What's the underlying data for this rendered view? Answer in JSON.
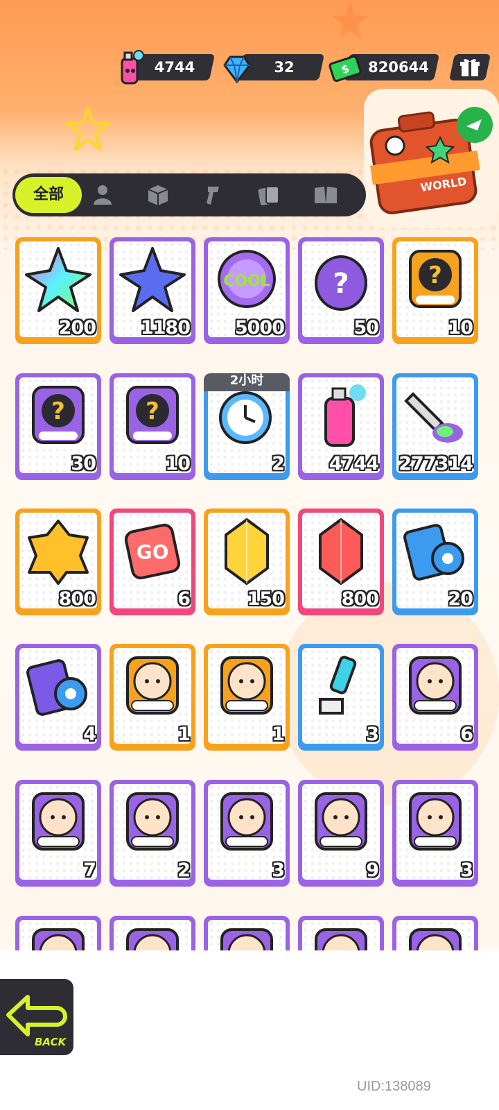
{
  "currencies": {
    "spray": "4744",
    "diamond": "32",
    "cash": "820644"
  },
  "event_banner": {
    "label": "WORLD"
  },
  "tabs": {
    "all_label": "全部",
    "icons": [
      "person-icon",
      "box-icon",
      "spray-gun-icon",
      "cards-icon",
      "book-icon"
    ]
  },
  "items": [
    {
      "name": "rainbow-star-crystal",
      "qty": "200",
      "rarity": "orange"
    },
    {
      "name": "blue-star-crystal",
      "qty": "1180",
      "rarity": "purple"
    },
    {
      "name": "cool-badge-coin",
      "qty": "5000",
      "rarity": "purple"
    },
    {
      "name": "mystery-egg",
      "qty": "50",
      "rarity": "purple"
    },
    {
      "name": "deity-mystery-badge-gold",
      "qty": "10",
      "rarity": "orange"
    },
    {
      "name": "deity-mystery-badge-purple",
      "qty": "30",
      "rarity": "purple"
    },
    {
      "name": "travel-mystery-card",
      "qty": "10",
      "rarity": "purple"
    },
    {
      "name": "alarm-clock-paint",
      "qty": "2",
      "rarity": "blue",
      "timer": "2小时"
    },
    {
      "name": "spray-can",
      "qty": "4744",
      "rarity": "purple"
    },
    {
      "name": "paint-tube",
      "qty": "277314",
      "rarity": "blue"
    },
    {
      "name": "gold-nugget",
      "qty": "800",
      "rarity": "orange"
    },
    {
      "name": "go-dice",
      "qty": "6",
      "rarity": "pink"
    },
    {
      "name": "yellow-gem",
      "qty": "150",
      "rarity": "orange"
    },
    {
      "name": "red-gem",
      "qty": "800",
      "rarity": "pink"
    },
    {
      "name": "blue-ticket-card",
      "qty": "20",
      "rarity": "blue"
    },
    {
      "name": "purple-ticket-card",
      "qty": "4",
      "rarity": "purple"
    },
    {
      "name": "deity-character-badge-1",
      "qty": "1",
      "rarity": "orange"
    },
    {
      "name": "deity-character-badge-2",
      "qty": "1",
      "rarity": "orange"
    },
    {
      "name": "usb-key",
      "qty": "3",
      "rarity": "blue"
    },
    {
      "name": "deity-character-badge-3",
      "qty": "6",
      "rarity": "purple"
    },
    {
      "name": "deity-character-badge-4",
      "qty": "7",
      "rarity": "purple"
    },
    {
      "name": "deity-character-badge-5",
      "qty": "2",
      "rarity": "purple"
    },
    {
      "name": "deity-character-badge-6",
      "qty": "3",
      "rarity": "purple"
    },
    {
      "name": "deity-character-badge-7",
      "qty": "9",
      "rarity": "purple"
    },
    {
      "name": "deity-character-badge-8",
      "qty": "3",
      "rarity": "purple"
    },
    {
      "name": "deity-character-badge-9",
      "qty": "",
      "rarity": "purple"
    },
    {
      "name": "deity-character-badge-10",
      "qty": "",
      "rarity": "purple"
    },
    {
      "name": "deity-character-badge-11",
      "qty": "",
      "rarity": "purple"
    },
    {
      "name": "deity-character-badge-12",
      "qty": "",
      "rarity": "purple"
    },
    {
      "name": "deity-character-badge-13",
      "qty": "",
      "rarity": "purple"
    }
  ],
  "back_label": "BACK",
  "uid": "UID:138089",
  "colors": {
    "orange": "#f7a21c",
    "purple": "#9a63e6",
    "blue": "#3d9bef",
    "pink": "#f0477d",
    "accent": "#d8f22a",
    "dark": "#2d2d33"
  }
}
